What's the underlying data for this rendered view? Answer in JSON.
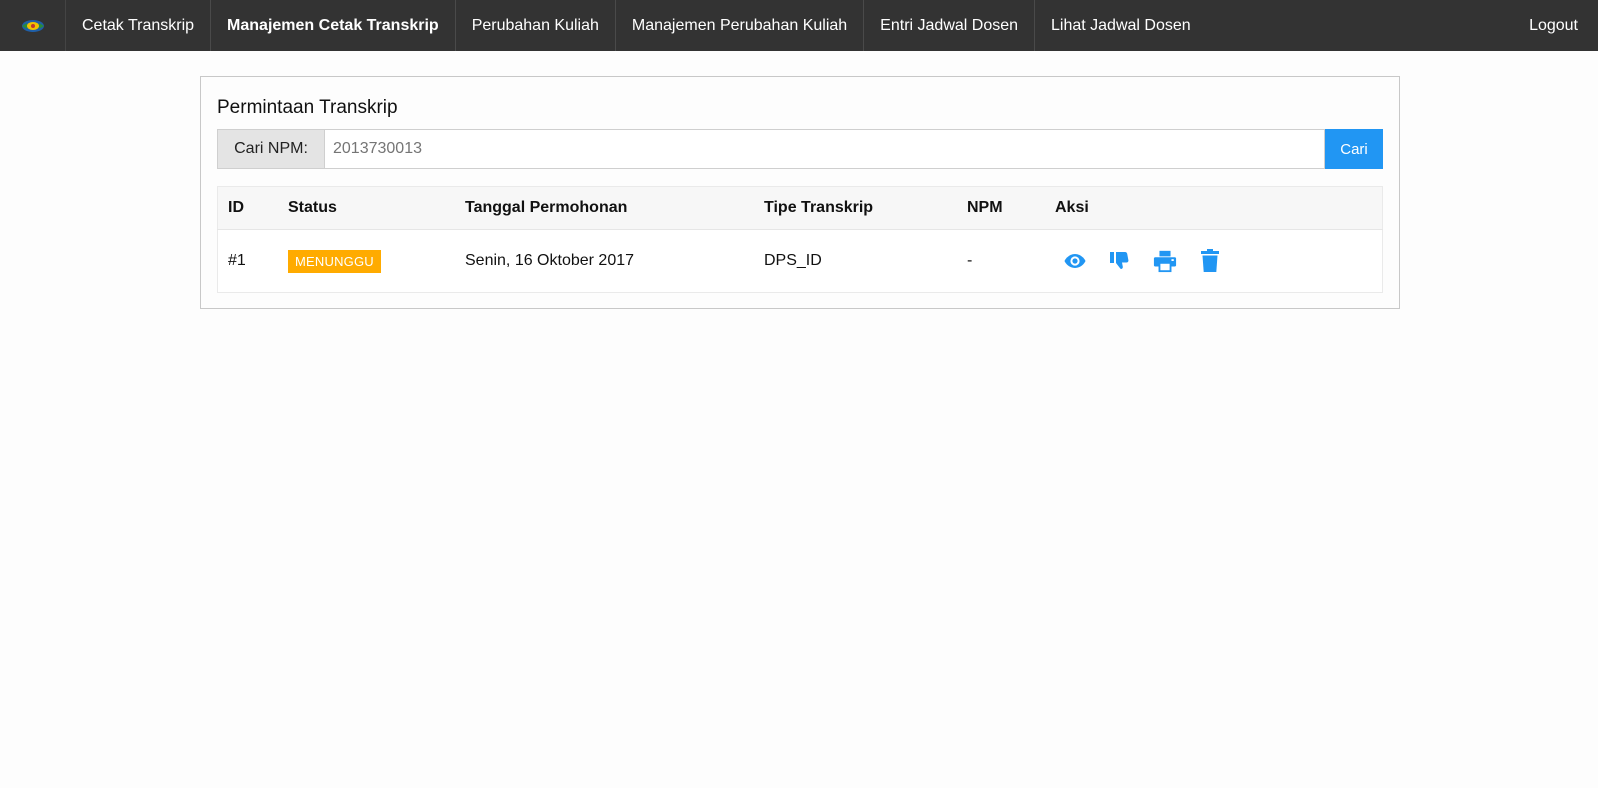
{
  "nav": {
    "logo_icon": "university-seal-icon",
    "items": [
      {
        "label": "Cetak Transkrip",
        "active": false
      },
      {
        "label": "Manajemen Cetak Transkrip",
        "active": true
      },
      {
        "label": "Perubahan Kuliah",
        "active": false
      },
      {
        "label": "Manajemen Perubahan Kuliah",
        "active": false
      },
      {
        "label": "Entri Jadwal Dosen",
        "active": false
      },
      {
        "label": "Lihat Jadwal Dosen",
        "active": false
      }
    ],
    "logout": "Logout"
  },
  "card": {
    "title": "Permintaan Transkrip",
    "search": {
      "label": "Cari NPM:",
      "placeholder": "2013730013",
      "button": "Cari"
    },
    "table": {
      "columns": [
        "ID",
        "Status",
        "Tanggal Permohonan",
        "Tipe Transkrip",
        "NPM",
        "Aksi"
      ],
      "rows": [
        {
          "id": "#1",
          "status": "MENUNGGU",
          "tanggal": "Senin, 16 Oktober 2017",
          "tipe": "DPS_ID",
          "npm": "-",
          "actions": [
            "eye-icon",
            "thumbs-down-icon",
            "print-icon",
            "trash-icon"
          ]
        }
      ]
    }
  },
  "colors": {
    "navbar": "#333333",
    "accent": "#2196f3",
    "badge": "#ffab00"
  }
}
